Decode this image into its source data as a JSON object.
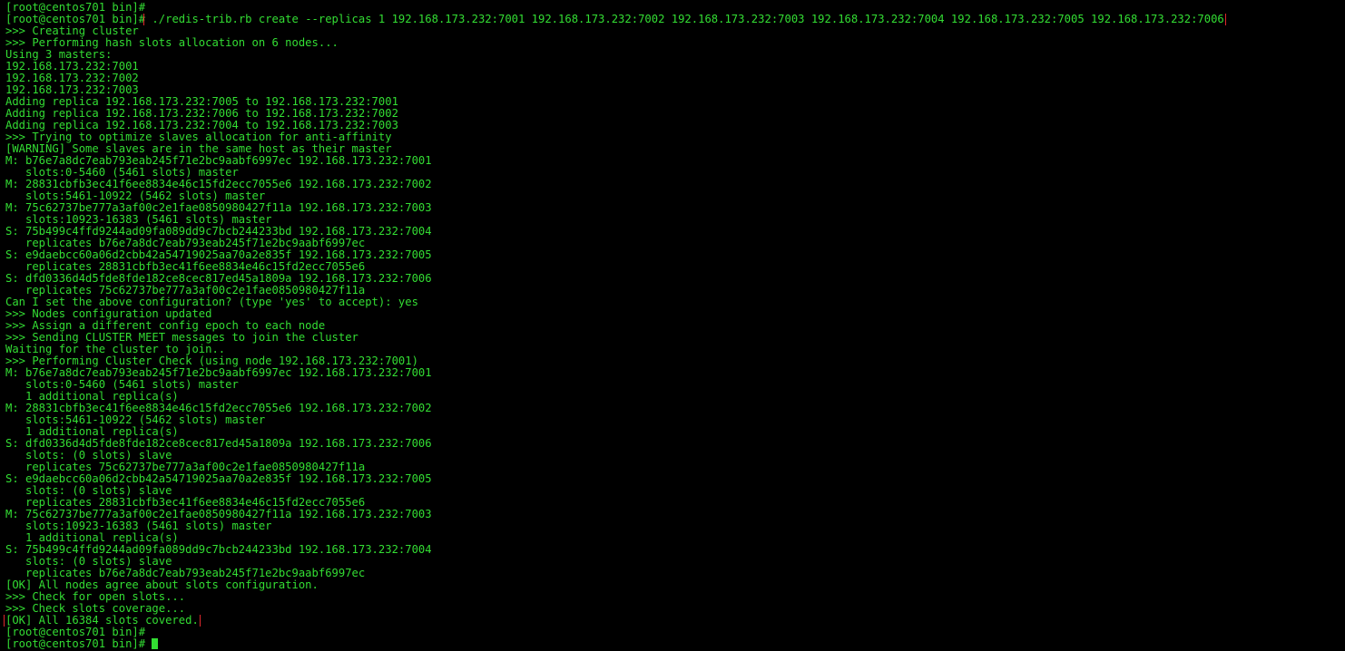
{
  "terminal": {
    "colors": {
      "background": "#000000",
      "text": "#33dd33",
      "highlight_box": "#e0282c"
    },
    "lines": [
      {
        "prompt": "[root@centos701 bin]#",
        "text": ""
      },
      {
        "prompt": "[root@centos701 bin]#",
        "text": " ./redis-trib.rb create --replicas 1 192.168.173.232:7001 192.168.173.232:7002 192.168.173.232:7003 192.168.173.232:7004 192.168.173.232:7005 192.168.173.232:7006"
      },
      {
        "text": ">>> Creating cluster"
      },
      {
        "text": ">>> Performing hash slots allocation on 6 nodes..."
      },
      {
        "text": "Using 3 masters:"
      },
      {
        "text": "192.168.173.232:7001"
      },
      {
        "text": "192.168.173.232:7002"
      },
      {
        "text": "192.168.173.232:7003"
      },
      {
        "text": "Adding replica 192.168.173.232:7005 to 192.168.173.232:7001"
      },
      {
        "text": "Adding replica 192.168.173.232:7006 to 192.168.173.232:7002"
      },
      {
        "text": "Adding replica 192.168.173.232:7004 to 192.168.173.232:7003"
      },
      {
        "text": ">>> Trying to optimize slaves allocation for anti-affinity"
      },
      {
        "text": "[WARNING] Some slaves are in the same host as their master"
      },
      {
        "text": "M: b76e7a8dc7eab793eab245f71e2bc9aabf6997ec 192.168.173.232:7001"
      },
      {
        "text": "   slots:0-5460 (5461 slots) master"
      },
      {
        "text": "M: 28831cbfb3ec41f6ee8834e46c15fd2ecc7055e6 192.168.173.232:7002"
      },
      {
        "text": "   slots:5461-10922 (5462 slots) master"
      },
      {
        "text": "M: 75c62737be777a3af00c2e1fae0850980427f11a 192.168.173.232:7003"
      },
      {
        "text": "   slots:10923-16383 (5461 slots) master"
      },
      {
        "text": "S: 75b499c4ffd9244ad09fa089dd9c7bcb244233bd 192.168.173.232:7004"
      },
      {
        "text": "   replicates b76e7a8dc7eab793eab245f71e2bc9aabf6997ec"
      },
      {
        "text": "S: e9daebcc60a06d2cbb42a54719025aa70a2e835f 192.168.173.232:7005"
      },
      {
        "text": "   replicates 28831cbfb3ec41f6ee8834e46c15fd2ecc7055e6"
      },
      {
        "text": "S: dfd0336d4d5fde8fde182ce8cec817ed45a1809a 192.168.173.232:7006"
      },
      {
        "text": "   replicates 75c62737be777a3af00c2e1fae0850980427f11a"
      },
      {
        "text": "Can I set the above configuration? (type 'yes' to accept): yes"
      },
      {
        "text": ">>> Nodes configuration updated"
      },
      {
        "text": ">>> Assign a different config epoch to each node"
      },
      {
        "text": ">>> Sending CLUSTER MEET messages to join the cluster"
      },
      {
        "text": "Waiting for the cluster to join.."
      },
      {
        "text": ">>> Performing Cluster Check (using node 192.168.173.232:7001)"
      },
      {
        "text": "M: b76e7a8dc7eab793eab245f71e2bc9aabf6997ec 192.168.173.232:7001"
      },
      {
        "text": "   slots:0-5460 (5461 slots) master"
      },
      {
        "text": "   1 additional replica(s)"
      },
      {
        "text": "M: 28831cbfb3ec41f6ee8834e46c15fd2ecc7055e6 192.168.173.232:7002"
      },
      {
        "text": "   slots:5461-10922 (5462 slots) master"
      },
      {
        "text": "   1 additional replica(s)"
      },
      {
        "text": "S: dfd0336d4d5fde8fde182ce8cec817ed45a1809a 192.168.173.232:7006"
      },
      {
        "text": "   slots: (0 slots) slave"
      },
      {
        "text": "   replicates 75c62737be777a3af00c2e1fae0850980427f11a"
      },
      {
        "text": "S: e9daebcc60a06d2cbb42a54719025aa70a2e835f 192.168.173.232:7005"
      },
      {
        "text": "   slots: (0 slots) slave"
      },
      {
        "text": "   replicates 28831cbfb3ec41f6ee8834e46c15fd2ecc7055e6"
      },
      {
        "text": "M: 75c62737be777a3af00c2e1fae0850980427f11a 192.168.173.232:7003"
      },
      {
        "text": "   slots:10923-16383 (5461 slots) master"
      },
      {
        "text": "   1 additional replica(s)"
      },
      {
        "text": "S: 75b499c4ffd9244ad09fa089dd9c7bcb244233bd 192.168.173.232:7004"
      },
      {
        "text": "   slots: (0 slots) slave"
      },
      {
        "text": "   replicates b76e7a8dc7eab793eab245f71e2bc9aabf6997ec"
      },
      {
        "text": "[OK] All nodes agree about slots configuration."
      },
      {
        "text": ">>> Check for open slots..."
      },
      {
        "text": ">>> Check slots coverage..."
      },
      {
        "text": "[OK] All 16384 slots covered.",
        "highlight": true
      },
      {
        "prompt": "[root@centos701 bin]#",
        "text": ""
      },
      {
        "prompt": "[root@centos701 bin]#",
        "text": " ",
        "cursor": true
      }
    ]
  }
}
